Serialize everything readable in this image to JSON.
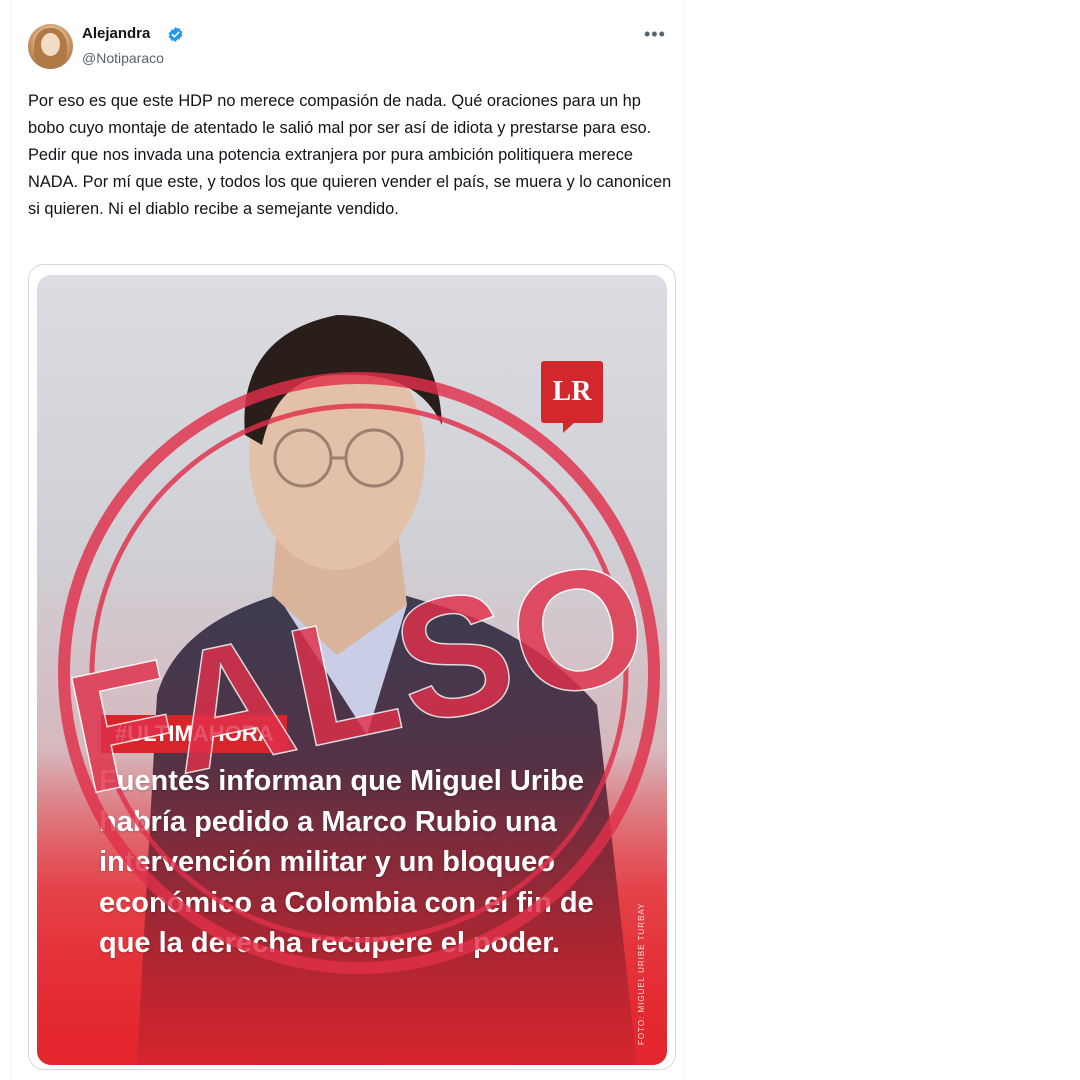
{
  "tweet": {
    "author": {
      "display_name": "Alejandra",
      "handle": "@Notiparaco",
      "verified": true
    },
    "more_icon": "more-horizontal-icon",
    "text": "Por eso es que este HDP no merece compasión de nada. Qué oraciones para un hp bobo cuyo montaje de atentado le salió mal por ser así de idiota y prestarse para eso. Pedir que nos invada una potencia extranjera por pura ambición politiquera merece NADA. Por mí que este, y todos los que quieren vender el país, se muera y lo canonicen si quieren. Ni el diablo recibe a semejante vendido."
  },
  "media": {
    "logo_text": "LR",
    "hashtag": "#ULTIMAHORA",
    "headline": "Fuentes informan que Miguel Uribe habría pedido a Marco Rubio una intervención militar y un bloqueo económico a Colombia con el fin de que la derecha recupere el poder.",
    "photo_credit": "FOTO: MIGUEL URIBE TURBAY",
    "stamp_text": "FALSO",
    "colors": {
      "brand_red": "#d8242b",
      "stamp_red": "#e0304a",
      "verified_blue": "#1d9bf0"
    }
  }
}
